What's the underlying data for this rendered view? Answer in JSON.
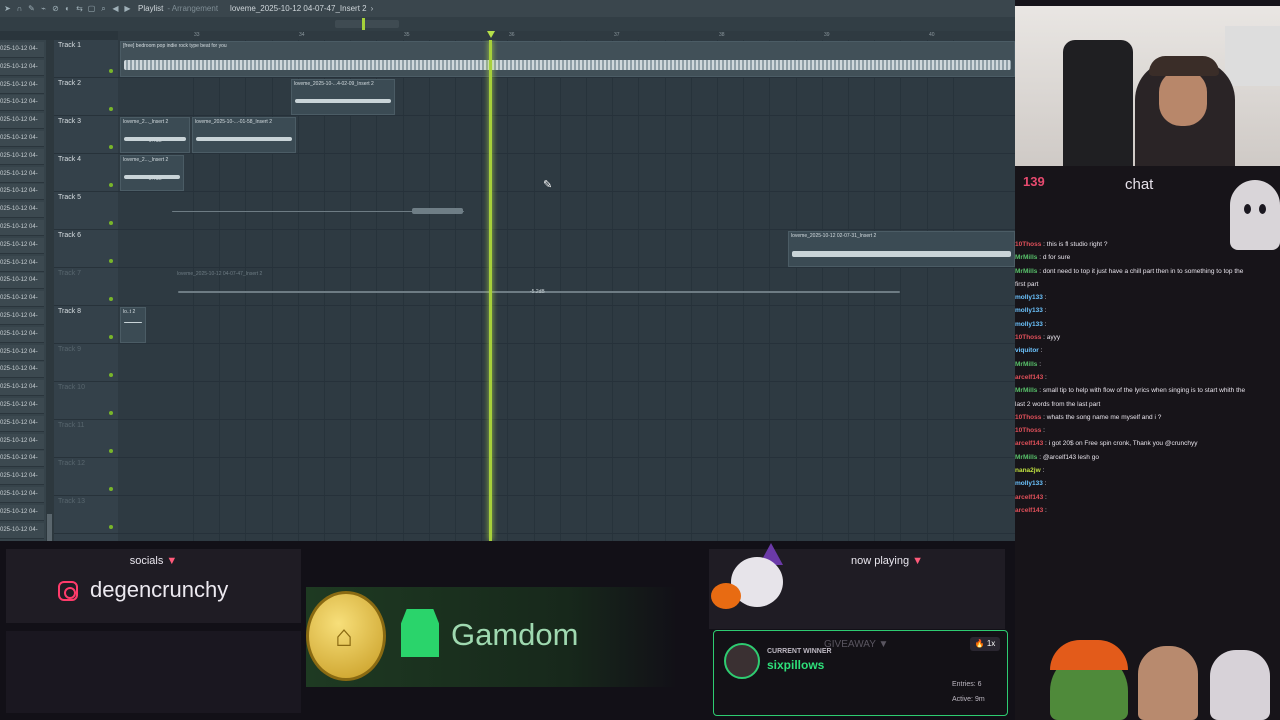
{
  "window": {
    "title": "Playlist",
    "subtitle": "- Arrangement",
    "insert_label": "loveme_2025-10-12 04-07-47_Insert 2",
    "insert_arrow": "›"
  },
  "toolbar_icons": [
    "cursor-icon",
    "magnet-icon",
    "pencil-icon",
    "brush-icon",
    "delete-icon",
    "mute-icon",
    "slip-icon",
    "select-icon",
    "zoom-icon",
    "playback-icon"
  ],
  "ruler": {
    "ticks": [
      {
        "label": "33"
      },
      {
        "label": "34"
      },
      {
        "label": "35"
      },
      {
        "label": "36"
      },
      {
        "label": "37"
      },
      {
        "label": "38"
      },
      {
        "label": "39"
      },
      {
        "label": "40"
      }
    ]
  },
  "sidebar": {
    "items": [
      "025-10-12 04-",
      "025-10-12 04-",
      "025-10-12 04-",
      "025-10-12 04-",
      "025-10-12 04-",
      "025-10-12 04-",
      "025-10-12 04-",
      "025-10-12 04-",
      "025-10-12 04-",
      "025-10-12 04-",
      "025-10-12 04-",
      "025-10-12 04-",
      "025-10-12 04-",
      "025-10-12 04-",
      "025-10-12 04-",
      "025-10-12 04-",
      "025-10-12 04-",
      "025-10-12 04-",
      "025-10-12 04-",
      "025-10-12 04-",
      "025-10-12 04-",
      "025-10-12 04-",
      "025-10-12 04-",
      "025-10-12 04-",
      "025-10-12 04-",
      "025-10-12 04-",
      "025-10-12 04-",
      "025-10-12 04-"
    ]
  },
  "tracks": [
    {
      "name": "Track 1",
      "dim": false
    },
    {
      "name": "Track 2",
      "dim": false
    },
    {
      "name": "Track 3",
      "dim": false
    },
    {
      "name": "Track 4",
      "dim": false
    },
    {
      "name": "Track 5",
      "dim": false
    },
    {
      "name": "Track 6",
      "dim": false
    },
    {
      "name": "Track 7",
      "dim": true
    },
    {
      "name": "Track 8",
      "dim": false
    },
    {
      "name": "Track 9",
      "dim": true
    },
    {
      "name": "Track 10",
      "dim": true
    },
    {
      "name": "Track 11",
      "dim": true
    },
    {
      "name": "Track 12",
      "dim": true
    },
    {
      "name": "Track 13",
      "dim": true
    }
  ],
  "clips": [
    {
      "label": "[free] bedroom pop  indie rock type beat for you",
      "gain": ""
    },
    {
      "label": "loveme_2025-10-...4-02-09_Insert 2",
      "gain": ""
    },
    {
      "label": "loveme_2..._Insert 2",
      "gain": "-6.4dB"
    },
    {
      "label": "loveme_2025-10-...-01-58_Insert 2",
      "gain": ""
    },
    {
      "label": "loveme_2..._Insert 2",
      "gain": "-5.4dB"
    },
    {
      "label": "",
      "gain": ""
    },
    {
      "label": "loveme_2025-10-12 02-07-31_Insert 2",
      "gain": ""
    },
    {
      "label": "loveme_2025-10-12 04-07-47_Insert 2",
      "gain": "-5.2dB"
    },
    {
      "label": "lo..t 2",
      "gain": ""
    }
  ],
  "chat": {
    "viewer_count": "139",
    "title": "chat",
    "messages": [
      {
        "user": "10Thoss",
        "text": "this is fl studio right ?",
        "color": "#e0505a"
      },
      {
        "user": "MrMills",
        "text": "d for sure",
        "color": "#58c06a"
      },
      {
        "user": "MrMills",
        "text": "dont need to top it just have a chill part then in to something to top the",
        "color": "#58c06a"
      },
      {
        "user": "",
        "text": "first part",
        "color": "#58c06a"
      },
      {
        "user": "molly133",
        "text": "",
        "color": "#6cc4ff"
      },
      {
        "user": "molly133",
        "text": "",
        "color": "#6cc4ff"
      },
      {
        "user": "molly133",
        "text": "",
        "color": "#6cc4ff"
      },
      {
        "user": "10Thoss",
        "text": "ayyy",
        "color": "#e0505a"
      },
      {
        "user": "viquitor",
        "text": "",
        "color": "#6cc4ff"
      },
      {
        "user": "MrMills",
        "text": "",
        "color": "#58c06a"
      },
      {
        "user": "arcelf143",
        "text": "",
        "color": "#e0505a"
      },
      {
        "user": "MrMills",
        "text": "small tip to help with flow of the lyrics when singing is to start whith the",
        "color": "#58c06a"
      },
      {
        "user": "",
        "text": "last 2 words from the last part",
        "color": "#58c06a"
      },
      {
        "user": "10Thoss",
        "text": "whats the song name me myself and i ?",
        "color": "#e0505a"
      },
      {
        "user": "10Thoss",
        "text": "",
        "color": "#e0505a"
      },
      {
        "user": "arcelf143",
        "text": "i got 20$ on Free spin cronk, Thank you @crunchyy",
        "color": "#e0505a"
      },
      {
        "user": "MrMills",
        "text": "@arcelf143 lesh go",
        "color": "#58c06a"
      },
      {
        "user": "nana2jw",
        "text": "",
        "color": "#c0e040"
      },
      {
        "user": "molly133",
        "text": "",
        "color": "#6cc4ff"
      },
      {
        "user": "arcelf143",
        "text": "",
        "color": "#e0505a"
      },
      {
        "user": "arcelf143",
        "text": "",
        "color": "#e0505a"
      }
    ]
  },
  "socials": {
    "title": "socials",
    "arrow": "▼",
    "handle": "degencrunchy"
  },
  "sponsor": {
    "name": "Gamdom"
  },
  "now_playing": {
    "title": "now playing",
    "arrow": "▼"
  },
  "giveaway": {
    "label": "GIVEAWAY ▼",
    "current_winner_label": "CURRENT WINNER",
    "winner": "sixpillows",
    "badge": "🔥 1x",
    "entries": "Entries: 6",
    "active": "Active: 9m"
  },
  "colors": {
    "playhead": "#a7d03b",
    "giveaway_accent": "#2ecc71",
    "viewer_count": "#e74a6f"
  }
}
